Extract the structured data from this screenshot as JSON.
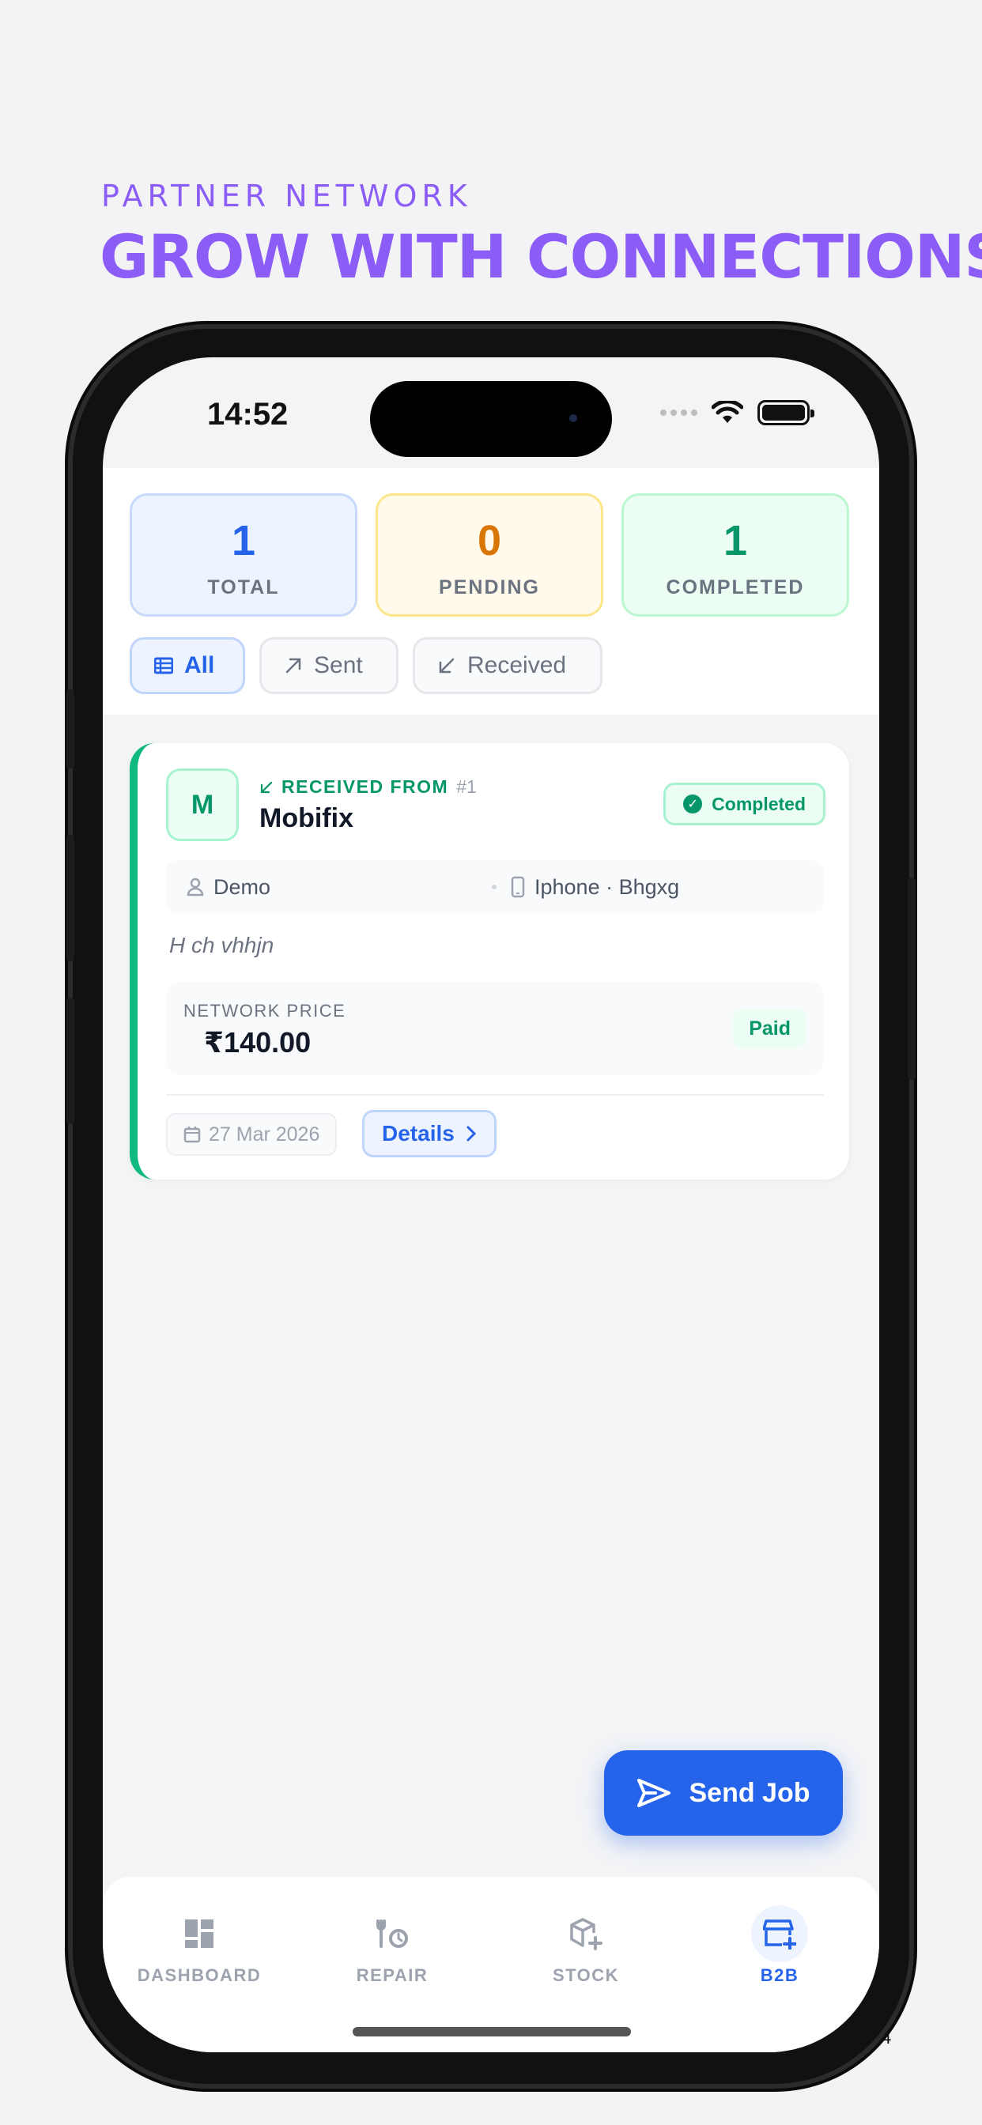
{
  "header": {
    "eyebrow": "PARTNER NETWORK",
    "headline": "GROW WITH CONNECTIONS"
  },
  "status_bar": {
    "time": "14:52"
  },
  "stats": [
    {
      "value": "1",
      "label": "TOTAL"
    },
    {
      "value": "0",
      "label": "PENDING"
    },
    {
      "value": "1",
      "label": "COMPLETED"
    }
  ],
  "filters": [
    {
      "label": "All",
      "icon": "list-icon",
      "active": true
    },
    {
      "label": "Sent",
      "icon": "arrow-up-right-icon",
      "active": false
    },
    {
      "label": "Received",
      "icon": "arrow-down-left-icon",
      "active": false
    }
  ],
  "job_card": {
    "avatar_letter": "M",
    "direction_label": "RECEIVED FROM",
    "job_number": "#1",
    "partner_name": "Mobifix",
    "status": "Completed",
    "customer": "Demo",
    "device": "Iphone · Bhgxg",
    "note": "H ch vhhjn",
    "price_label": "NETWORK PRICE",
    "price": "₹140.00",
    "payment_status": "Paid",
    "date": "27 Mar 2026",
    "details_label": "Details"
  },
  "fab": {
    "label": "Send Job"
  },
  "tabs": [
    {
      "label": "DASHBOARD",
      "icon": "dashboard-icon",
      "active": false
    },
    {
      "label": "REPAIR",
      "icon": "repair-icon",
      "active": false
    },
    {
      "label": "STOCK",
      "icon": "stock-icon",
      "active": false
    },
    {
      "label": "B2B",
      "icon": "b2b-store-icon",
      "active": true
    }
  ],
  "page_number": "4",
  "colors": {
    "brand_purple": "#8b5cf6",
    "primary_blue": "#2563eb",
    "success_green": "#059669",
    "warning_orange": "#d97706"
  }
}
